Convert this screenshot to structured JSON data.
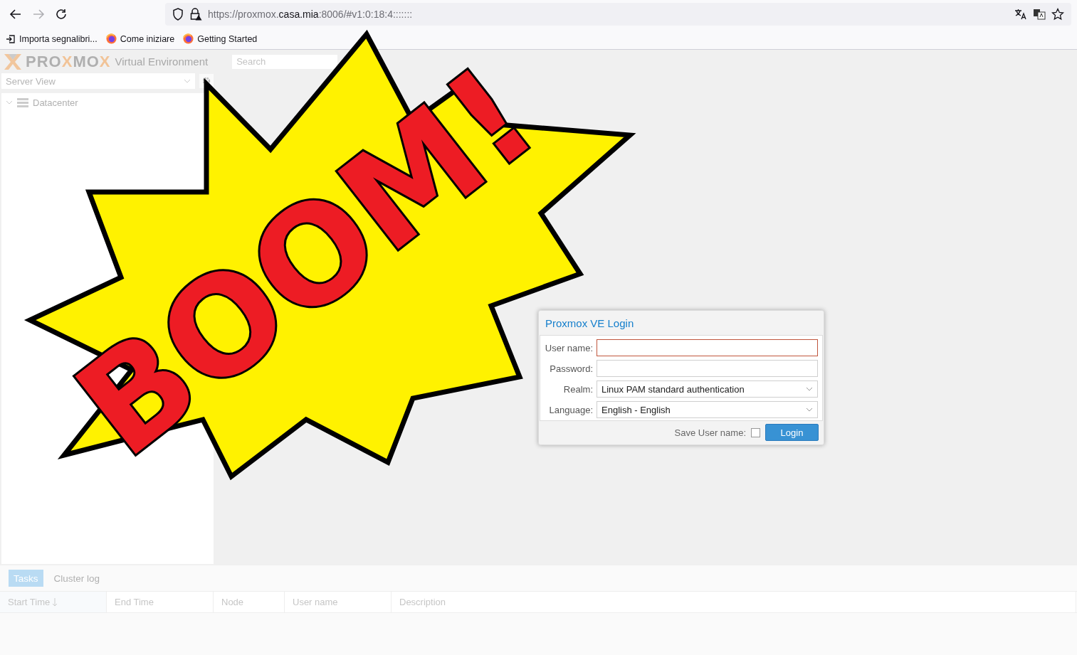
{
  "browser": {
    "back_enabled": true,
    "forward_enabled": false,
    "url": {
      "prefix": "https://proxmox.",
      "host": "casa.mia",
      "suffix": ":8006/#v1:0:18:4:::::::"
    },
    "bookmarks": [
      {
        "kind": "import",
        "label": "Importa segnalibri..."
      },
      {
        "kind": "firefox",
        "label": "Come iniziare"
      },
      {
        "kind": "firefox",
        "label": "Getting Started"
      }
    ]
  },
  "header": {
    "logo": {
      "parts": [
        {
          "text": "PRO",
          "kind": "plain"
        },
        {
          "text": "X",
          "kind": "accent"
        },
        {
          "text": "MO",
          "kind": "plain"
        },
        {
          "text": "X",
          "kind": "accent"
        }
      ]
    },
    "product": "Virtual Environment",
    "search": {
      "placeholder": "Search"
    }
  },
  "sidebar": {
    "view": "Server View",
    "tree": [
      {
        "label": "Datacenter",
        "expanded": true
      }
    ]
  },
  "login": {
    "title": "Proxmox VE Login",
    "fields": [
      {
        "kind": "text",
        "label": "User name:",
        "invalid": true
      },
      {
        "kind": "password",
        "label": "Password:",
        "invalid": false
      },
      {
        "kind": "select",
        "label": "Realm:",
        "value": "Linux PAM standard authentication",
        "invalid": false
      },
      {
        "kind": "select",
        "label": "Language:",
        "value": "English - English",
        "invalid": false
      }
    ],
    "save_user": {
      "label": "Save User name:",
      "checked": false
    },
    "button": "Login"
  },
  "bottom": {
    "tabs": [
      {
        "label": "Tasks",
        "selected": true
      },
      {
        "label": "Cluster log",
        "selected": false
      }
    ],
    "columns": [
      {
        "label": "Start Time",
        "sorted": true
      },
      {
        "label": "End Time",
        "sorted": false
      },
      {
        "label": "Node",
        "sorted": false
      },
      {
        "label": "User name",
        "sorted": false
      },
      {
        "label": "Description",
        "sorted": false
      }
    ]
  },
  "overlay": {
    "text": "BOOM!"
  }
}
